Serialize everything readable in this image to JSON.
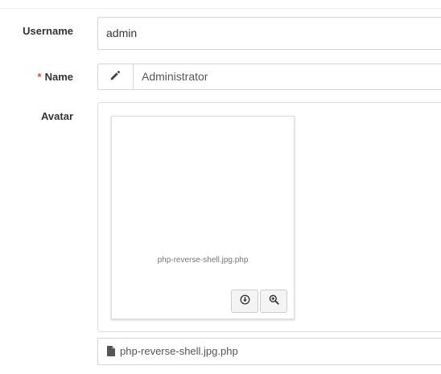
{
  "form": {
    "username": {
      "label": "Username",
      "value": "admin"
    },
    "name": {
      "required_marker": "*",
      "label": "Name",
      "value": "Administrator",
      "icon": "pencil-icon"
    },
    "avatar": {
      "label": "Avatar",
      "preview_caption": "php-reverse-shell.jpg.php",
      "download_icon": "download-circle-icon",
      "zoom_icon": "zoom-in-icon",
      "file_icon": "file-icon",
      "file_name": "php-reverse-shell.jpg.php"
    }
  },
  "colors": {
    "required": "#dd4b39",
    "border": "#d2d6de"
  }
}
